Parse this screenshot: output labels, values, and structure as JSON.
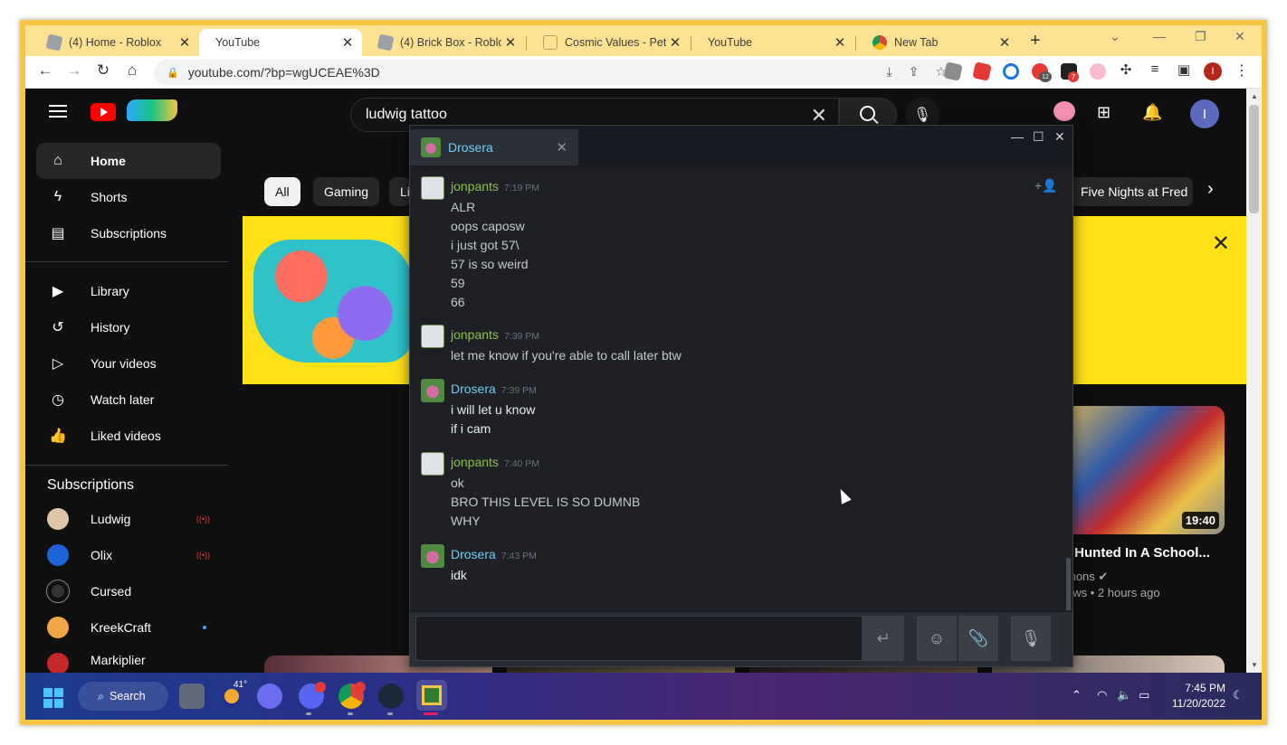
{
  "browser": {
    "tabs": [
      {
        "title": "(4) Home - Roblox",
        "icon": "roblox-icon"
      },
      {
        "title": "YouTube",
        "icon": "youtube-icon",
        "active": true
      },
      {
        "title": "(4) Brick Box - Roblox",
        "icon": "roblox-icon"
      },
      {
        "title": "Cosmic Values - Pet Si",
        "icon": "cosmic-values-icon"
      },
      {
        "title": "YouTube",
        "icon": "youtube-icon"
      },
      {
        "title": "New Tab",
        "icon": "chrome-icon"
      }
    ],
    "url": "youtube.com/?bp=wgUCEAE%3D",
    "profile_initial": "I",
    "ext_badge_1": "12",
    "ext_badge_2": "7"
  },
  "youtube": {
    "search_value": "ludwig tattoo",
    "avatar_initial": "I",
    "nav": [
      {
        "label": "Home",
        "icon": "home-icon",
        "active": true
      },
      {
        "label": "Shorts",
        "icon": "shorts-icon"
      },
      {
        "label": "Subscriptions",
        "icon": "subscriptions-icon"
      },
      {
        "label": "Library",
        "icon": "library-icon"
      },
      {
        "label": "History",
        "icon": "history-icon"
      },
      {
        "label": "Your videos",
        "icon": "your-videos-icon"
      },
      {
        "label": "Watch later",
        "icon": "watch-later-icon"
      },
      {
        "label": "Liked videos",
        "icon": "thumbs-up-icon"
      }
    ],
    "subscriptions_heading": "Subscriptions",
    "subscriptions": [
      {
        "name": "Ludwig",
        "status": "live"
      },
      {
        "name": "Olix",
        "status": "live"
      },
      {
        "name": "Cursed",
        "status": ""
      },
      {
        "name": "KreekCraft",
        "status": "new"
      },
      {
        "name": "Markiplier",
        "status": "new"
      }
    ],
    "chips": [
      "All",
      "Gaming",
      "Li",
      "Five Nights at Fred"
    ],
    "video": {
      "duration": "19:40",
      "title": "t Hunted In A School...",
      "channel": "mons",
      "meta": "ews • 2 hours ago"
    }
  },
  "chat": {
    "friend_name": "Drosera",
    "groups": [
      {
        "sender": "jonpants",
        "time": "7:19 PM",
        "who": "jon",
        "lines": [
          "ALR",
          "oops caposw",
          "i just got 57\\",
          "57 is so weird",
          "59",
          "66"
        ]
      },
      {
        "sender": "jonpants",
        "time": "7:39 PM",
        "who": "jon",
        "lines": [
          "let me know if you're able to call later btw"
        ]
      },
      {
        "sender": "Drosera",
        "time": "7:39 PM",
        "who": "dro",
        "lines": [
          "i will let u know",
          "if i cam"
        ]
      },
      {
        "sender": "jonpants",
        "time": "7:40 PM",
        "who": "jon",
        "lines": [
          "ok",
          "BRO THIS LEVEL IS SO DUMNB",
          "WHY"
        ]
      },
      {
        "sender": "Drosera",
        "time": "7:43 PM",
        "who": "dro",
        "lines": [
          "idk"
        ]
      }
    ]
  },
  "taskbar": {
    "search_label": "Search",
    "weather": "41°",
    "time": "7:45 PM",
    "date": "11/20/2022"
  }
}
